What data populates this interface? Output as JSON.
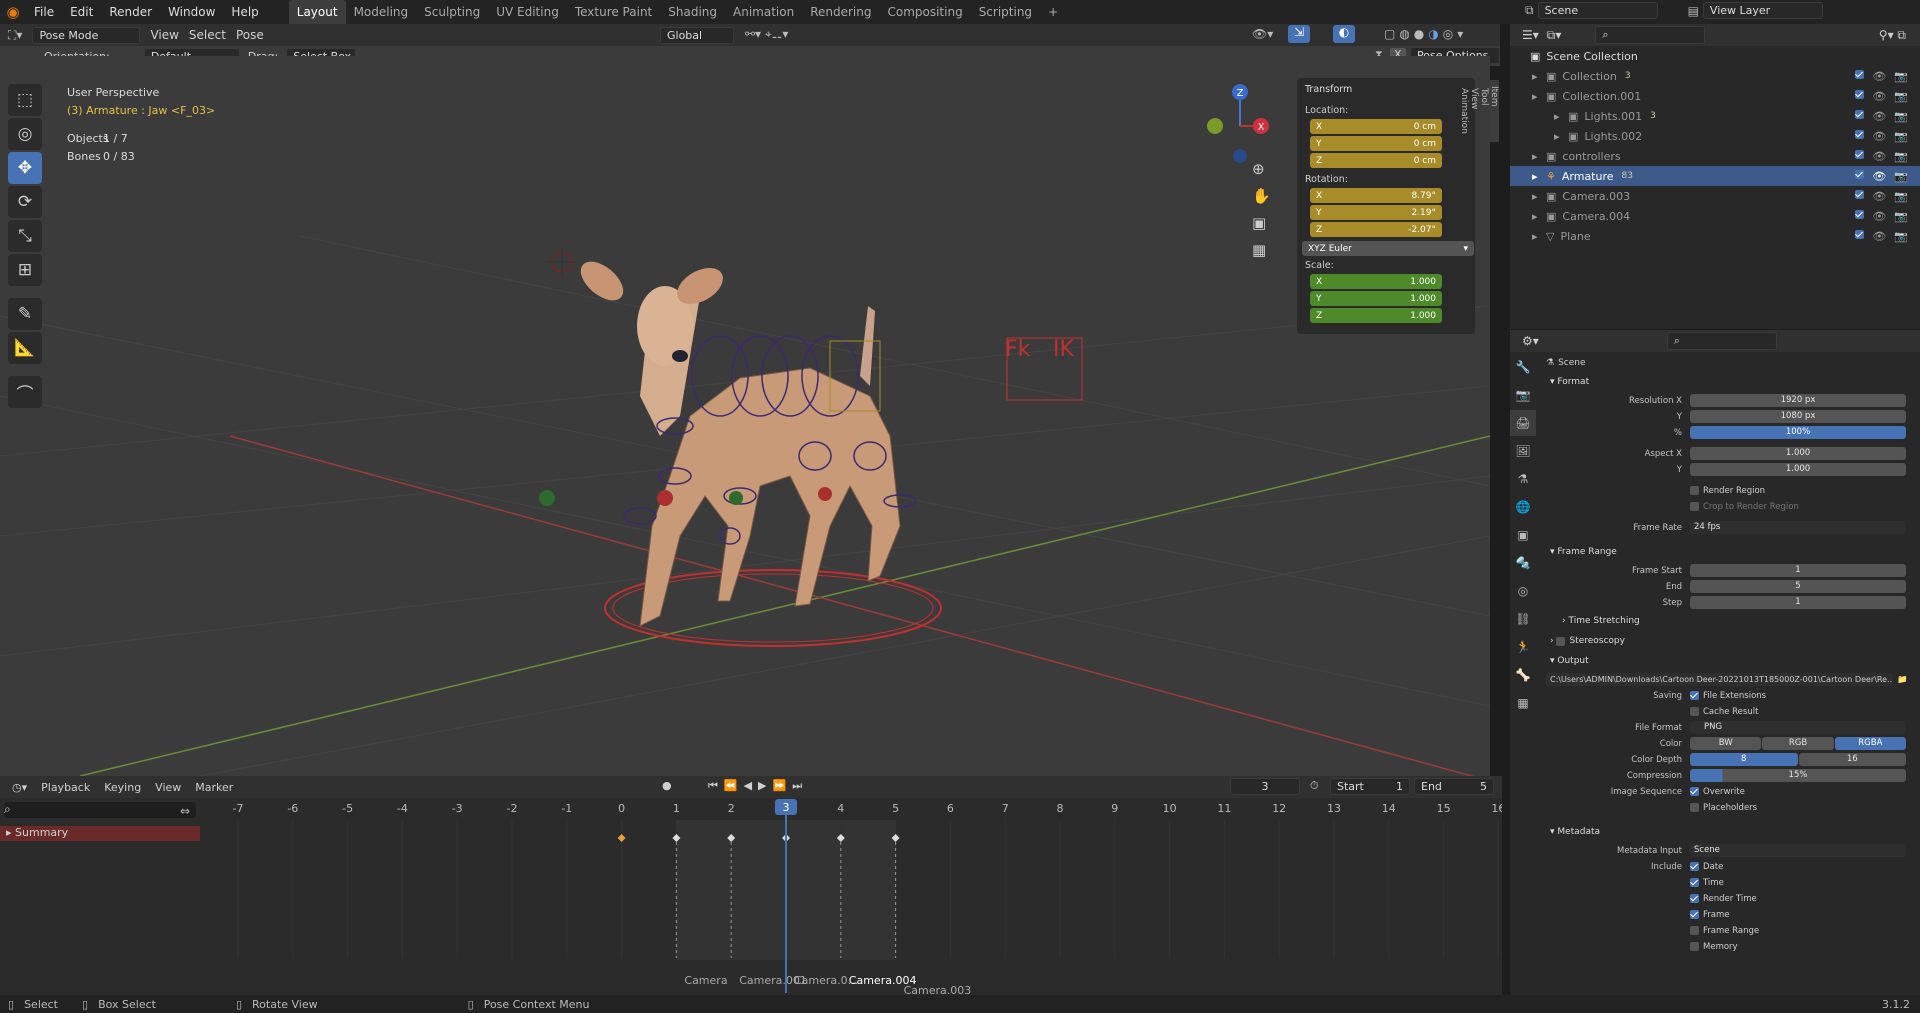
{
  "menu": [
    "File",
    "Edit",
    "Render",
    "Window",
    "Help"
  ],
  "workspaces": [
    "Layout",
    "Modeling",
    "Sculpting",
    "UV Editing",
    "Texture Paint",
    "Shading",
    "Animation",
    "Rendering",
    "Compositing",
    "Scripting"
  ],
  "plus": "+",
  "scene_label": "Scene",
  "view_layer": "View Layer",
  "header": {
    "mode": "Pose Mode",
    "view": "View",
    "select": "Select",
    "pose": "Pose",
    "orientation_label": "Orientation:",
    "orientation": "Default",
    "drag_label": "Drag:",
    "drag": "Select Box",
    "transform_space": "Global",
    "pose_options": "Pose Options",
    "x": "X"
  },
  "viewport": {
    "title": "User Perspective",
    "subtitle": "(3) Armature : Jaw <F_03>",
    "objects_label": "Objects",
    "objects_val": "1 / 7",
    "bones_label": "Bones",
    "bones_val": "0 / 83",
    "fk": "Fk",
    "ik": "IK",
    "gizmo_z": "Z",
    "gizmo_x": "X"
  },
  "npanel": {
    "tabs": [
      "Item",
      "Tool",
      "View",
      "Animation"
    ],
    "transform": "Transform",
    "location": "Location:",
    "rotation": "Rotation:",
    "scale": "Scale:",
    "loc": [
      [
        "X",
        "0 cm"
      ],
      [
        "Y",
        "0 cm"
      ],
      [
        "Z",
        "0 cm"
      ]
    ],
    "rot": [
      [
        "X",
        "8.79°"
      ],
      [
        "Y",
        "2.19°"
      ],
      [
        "Z",
        "-2.07°"
      ]
    ],
    "euler": "XYZ Euler",
    "scl": [
      [
        "X",
        "1.000"
      ],
      [
        "Y",
        "1.000"
      ],
      [
        "Z",
        "1.000"
      ]
    ]
  },
  "outliner": {
    "root": "Scene Collection",
    "rows": [
      {
        "name": "Collection",
        "indent": 1,
        "badge": "3"
      },
      {
        "name": "Collection.001",
        "indent": 1,
        "badge": ""
      },
      {
        "name": "Lights.001",
        "indent": 2,
        "badge": "3"
      },
      {
        "name": "Lights.002",
        "indent": 2,
        "badge": ""
      },
      {
        "name": "controllers",
        "indent": 1,
        "badge": ""
      },
      {
        "name": "Armature",
        "indent": 1,
        "badge": "83",
        "selected": true,
        "count": "6"
      },
      {
        "name": "Camera.003",
        "indent": 1,
        "badge": ""
      },
      {
        "name": "Camera.004",
        "indent": 1,
        "badge": ""
      },
      {
        "name": "Plane",
        "indent": 1,
        "badge": ""
      }
    ]
  },
  "props": {
    "context": "Scene",
    "format": "Format",
    "res_x_label": "Resolution X",
    "res_x": "1920 px",
    "y_label": "Y",
    "res_y": "1080 px",
    "pct_label": "%",
    "pct": "100%",
    "aspect_label": "Aspect X",
    "aspect_x": "1.000",
    "aspect_y": "1.000",
    "render_region": "Render Region",
    "crop": "Crop to Render Region",
    "frame_rate_label": "Frame Rate",
    "frame_rate": "24 fps",
    "frame_range": "Frame Range",
    "frame_start_label": "Frame Start",
    "frame_start": "1",
    "end_label": "End",
    "end": "5",
    "step_label": "Step",
    "step": "1",
    "time_stretching": "Time Stretching",
    "stereoscopy": "Stereoscopy",
    "output": "Output",
    "path": "C:\\Users\\ADMIN\\Downloads\\Cartoon Deer-20221013T185000Z-001\\Cartoon Deer\\Re...",
    "saving_label": "Saving",
    "file_ext": "File Extensions",
    "cache": "Cache Result",
    "file_format_label": "File Format",
    "file_format": "PNG",
    "color_label": "Color",
    "bw": "BW",
    "rgb": "RGB",
    "rgba": "RGBA",
    "depth_label": "Color Depth",
    "d8": "8",
    "d16": "16",
    "comp_label": "Compression",
    "comp": "15%",
    "imgseq_label": "Image Sequence",
    "overwrite": "Overwrite",
    "placeholders": "Placeholders",
    "metadata": "Metadata",
    "meta_input_label": "Metadata Input",
    "meta_input": "Scene",
    "include_label": "Include",
    "includes": [
      [
        "Date",
        true
      ],
      [
        "Time",
        true
      ],
      [
        "Render Time",
        true
      ],
      [
        "Frame",
        true
      ],
      [
        "Frame Range",
        false
      ],
      [
        "Memory",
        false
      ]
    ]
  },
  "timeline": {
    "playback": "Playback",
    "keying": "Keying",
    "view": "View",
    "marker": "Marker",
    "current": "3",
    "start_label": "Start",
    "start": "1",
    "end_label": "End",
    "end": "5",
    "summary": "Summary",
    "ticks": [
      "-7",
      "-6",
      "-5",
      "-4",
      "-3",
      "-2",
      "-1",
      "0",
      "1",
      "2",
      "3",
      "4",
      "5",
      "6",
      "7",
      "8",
      "9",
      "10",
      "11",
      "12",
      "13",
      "14",
      "15",
      "16"
    ],
    "markers": [
      "Camera",
      "Camera.001",
      "Camera.0...",
      "Camera.004",
      "Camera.003"
    ]
  },
  "status": {
    "select": "Select",
    "box_select": "Box Select",
    "rotate": "Rotate View",
    "context": "Pose Context Menu",
    "version": "3.1.2"
  },
  "colors": {
    "accent": "#4772b3",
    "keyframe_yellow": "#a88c2a",
    "scale_green": "#4e8a2a"
  }
}
